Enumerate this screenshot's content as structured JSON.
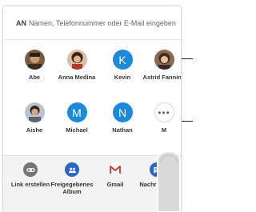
{
  "to_field": {
    "label": "AN",
    "placeholder": "Namen, Telefonnummer oder E-Mail eingeben"
  },
  "contacts": [
    {
      "name": "Abe",
      "avatar": "photo"
    },
    {
      "name": "Anna Medina",
      "avatar": "photo"
    },
    {
      "name": "Kevin",
      "avatar": "initial",
      "initial": "K"
    },
    {
      "name": "Astrid Fanning",
      "avatar": "photo"
    },
    {
      "name": "Aishe",
      "avatar": "photo"
    },
    {
      "name": "Michael",
      "avatar": "initial",
      "initial": "M"
    },
    {
      "name": "Nathan",
      "avatar": "initial",
      "initial": "N"
    },
    {
      "name": "M",
      "avatar": "more",
      "icon": "more-horiz-icon",
      "symbol": "•••"
    }
  ],
  "apps": [
    {
      "label": "Link erstellen",
      "icon": "link-icon",
      "color": "#757575"
    },
    {
      "label": "Freigegebenes Album",
      "icon": "shared-album-icon",
      "color": "#2a66c9"
    },
    {
      "label": "Gmail",
      "icon": "gmail-icon",
      "color": "#d93025"
    },
    {
      "label": "Nachrichten",
      "icon": "messages-icon",
      "color": "#2a66c9"
    }
  ],
  "colors": {
    "avatar_initial": "#1c8adb",
    "apps_bar": "#f3f3f3"
  }
}
